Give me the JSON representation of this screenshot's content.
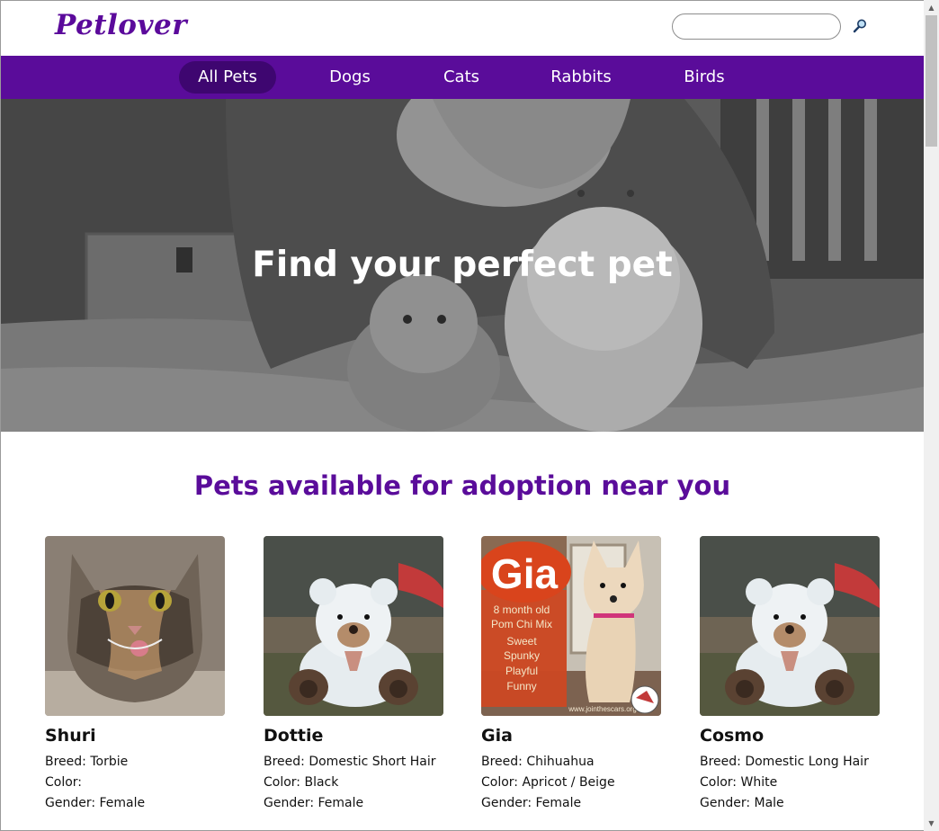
{
  "header": {
    "logo": "Petlover",
    "search": {
      "placeholder": "",
      "value": ""
    }
  },
  "nav": {
    "items": [
      {
        "label": "All Pets",
        "active": true
      },
      {
        "label": "Dogs"
      },
      {
        "label": "Cats"
      },
      {
        "label": "Rabbits"
      },
      {
        "label": "Birds"
      }
    ]
  },
  "hero": {
    "title": "Find your perfect pet"
  },
  "section": {
    "title": "Pets available for adoption near you"
  },
  "pets": [
    {
      "name": "Shuri",
      "breed": "Breed: Torbie",
      "color": "Color:",
      "gender": "Gender: Female",
      "photo": "cat-photo"
    },
    {
      "name": "Dottie",
      "breed": "Breed: Domestic Short Hair",
      "color": "Color: Black",
      "gender": "Gender: Female",
      "photo": "teddy-bear-photo"
    },
    {
      "name": "Gia",
      "breed": "Breed: Chihuahua",
      "color": "Color: Apricot / Beige",
      "gender": "Gender: Female",
      "photo": "dog-flyer-photo"
    },
    {
      "name": "Cosmo",
      "breed": "Breed: Domestic Long Hair",
      "color": "Color: White",
      "gender": "Gender: Male",
      "photo": "teddy-bear-photo"
    }
  ],
  "gia_flyer": {
    "title": "Gia",
    "lines": [
      "8 month old",
      "Pom Chi Mix",
      "Sweet",
      "Spunky",
      "Playful",
      "Funny"
    ],
    "url": "www.jointhescars.org"
  },
  "colors": {
    "brand": "#5a0c9a",
    "nav_active": "#3e0670",
    "flyer_orange": "#d9441c"
  }
}
